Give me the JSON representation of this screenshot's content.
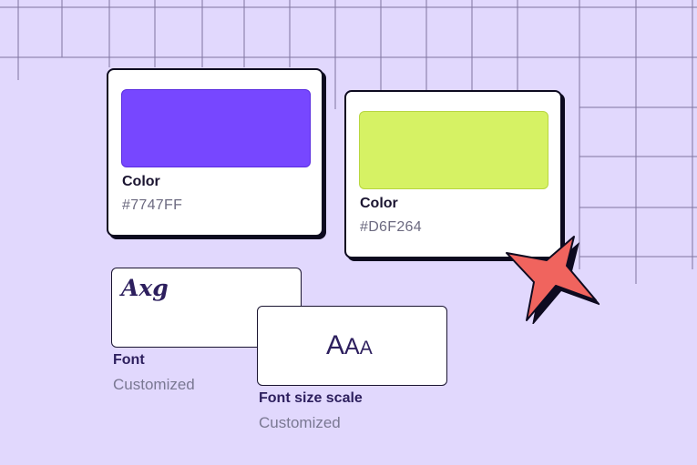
{
  "color_cards": [
    {
      "title": "Color",
      "hex_label": "#7747FF",
      "swatch_color": "#7747FF",
      "swatch_border": "#5a2ce0"
    },
    {
      "title": "Color",
      "hex_label": "#D6F264",
      "swatch_color": "#D6F264",
      "swatch_border": "#b8d640"
    }
  ],
  "font_card": {
    "sample": "Axg",
    "title": "Font",
    "subtitle": "Customized"
  },
  "font_size_card": {
    "sample_1": "A",
    "sample_2": "A",
    "sample_3": "A",
    "title": "Font size scale",
    "subtitle": "Customized"
  },
  "colors": {
    "background": "#E1D8FD",
    "grid_line": "#6e6490",
    "ink": "#0D0A1F",
    "star": "#F0645E"
  },
  "icons": {
    "decoration": "sparkle-star-icon"
  }
}
